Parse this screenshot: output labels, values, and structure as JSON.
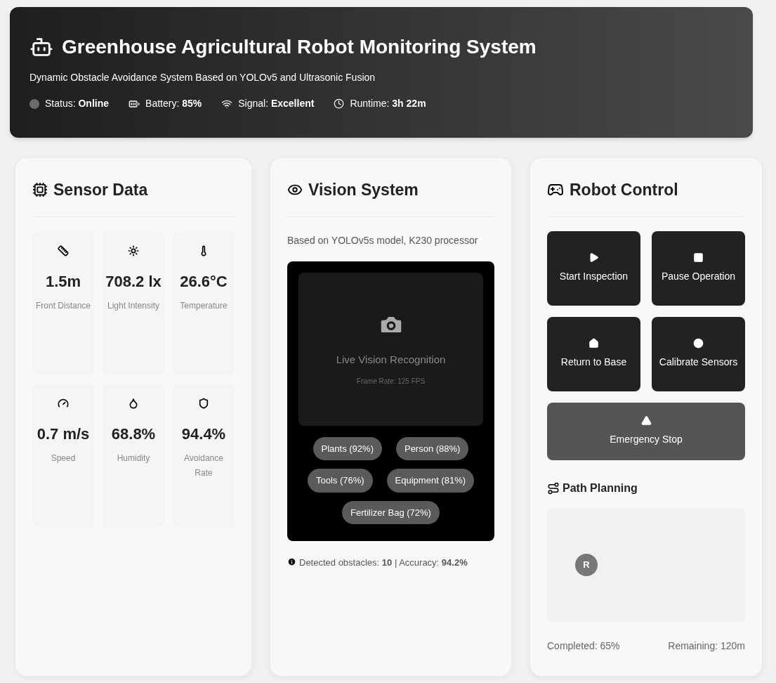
{
  "header": {
    "title": "Greenhouse Agricultural Robot Monitoring System",
    "subtitle": "Dynamic Obstacle Avoidance System Based on YOLOv5 and Ultrasonic Fusion",
    "status": [
      {
        "label": "Status:",
        "value": "Online"
      },
      {
        "label": "Battery:",
        "value": "85%"
      },
      {
        "label": "Signal:",
        "value": "Excellent"
      },
      {
        "label": "Runtime:",
        "value": "3h 22m"
      }
    ]
  },
  "sensor_panel": {
    "title": "Sensor Data",
    "sensors": [
      {
        "value": "1.5m",
        "label": "Front Distance"
      },
      {
        "value": "708.2 lx",
        "label": "Light Intensity"
      },
      {
        "value": "26.6°C",
        "label": "Temperature"
      },
      {
        "value": "0.7 m/s",
        "label": "Speed"
      },
      {
        "value": "68.8%",
        "label": "Humidity"
      },
      {
        "value": "94.4%",
        "label": "Avoidance Rate"
      }
    ]
  },
  "vision_panel": {
    "title": "Vision System",
    "description": "Based on YOLOv5s model, K230 processor",
    "feed_title": "Live Vision Recognition",
    "frame_rate": "Frame Rate: 125 FPS",
    "detections": [
      "Plants (92%)",
      "Person (88%)",
      "Tools (76%)",
      "Equipment (81%)",
      "Fertilizer Bag (72%)"
    ],
    "summary": "Detected obstacles: **10** | Accuracy: **94.2%**"
  },
  "control_panel": {
    "title": "Robot Control",
    "buttons": [
      {
        "label": "Start Inspection",
        "kind": "normal"
      },
      {
        "label": "Pause Operation",
        "kind": "normal"
      },
      {
        "label": "Return to Base",
        "kind": "normal"
      },
      {
        "label": "Calibrate Sensors",
        "kind": "normal"
      },
      {
        "label": "Emergency Stop",
        "kind": "danger"
      }
    ],
    "path_title": "Path Planning",
    "robot_marker": "R",
    "completed": "Completed: 65%",
    "remaining": "Remaining: 120m"
  }
}
